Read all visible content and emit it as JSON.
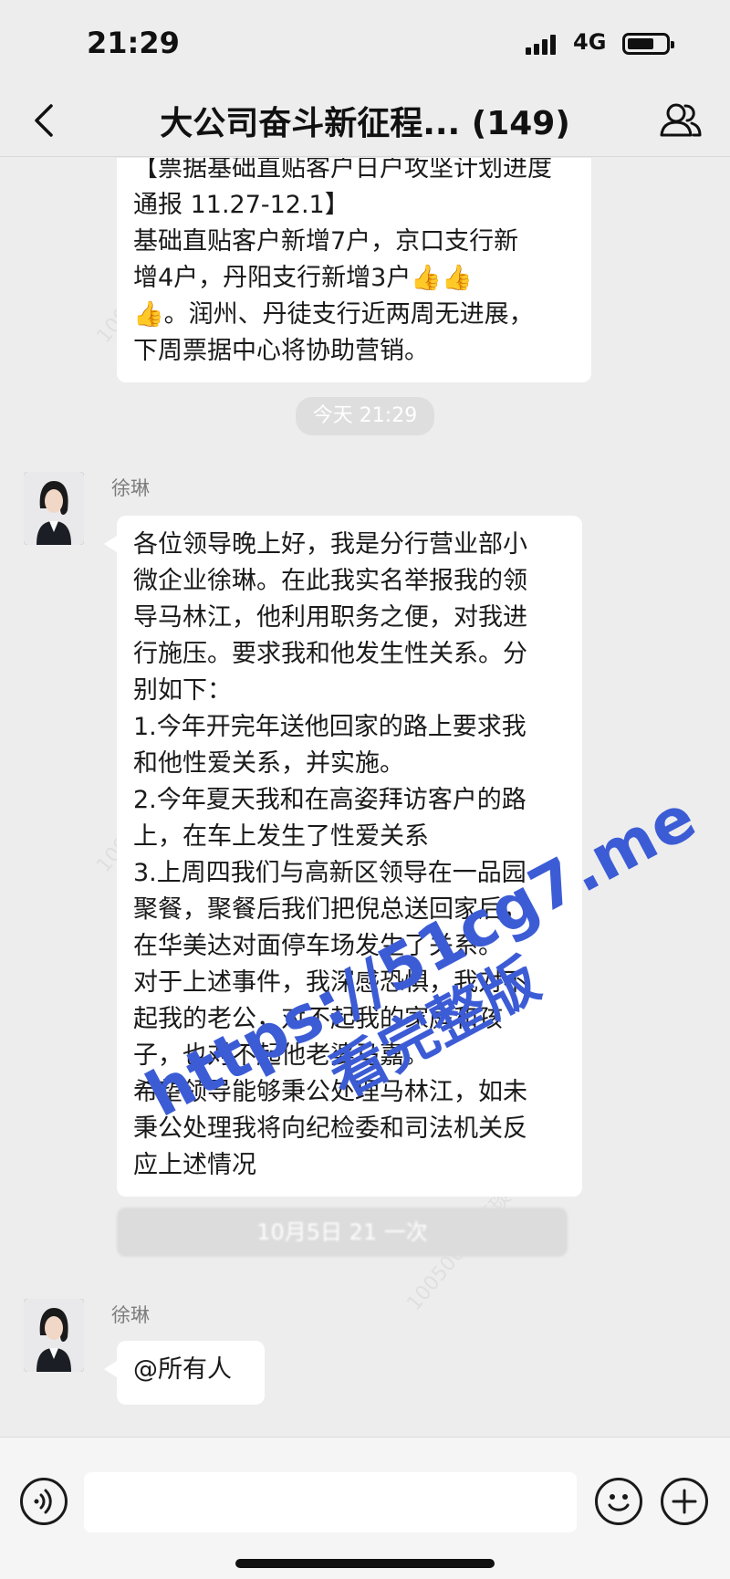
{
  "status_bar": {
    "time": "21:29",
    "network": "4G"
  },
  "nav": {
    "title": "大公司奋斗新征程... (149)"
  },
  "messages": {
    "previous_text": "【票据基础直贴客户日户攻坚计划进度\n通报 11.27-12.1】\n基础直贴客户新增7户，京口支行新\n增4户，丹阳支行新增3户👍👍\n👍。润州、丹徒支行近两周无进展，\n下周票据中心将协助营销。",
    "time_divider": "今天 21:29",
    "sender_1": "徐琳",
    "main_text": "各位领导晚上好，我是分行营业部小\n微企业徐琳。在此我实名举报我的领\n导马林江，他利用职务之便，对我进\n行施压。要求我和他发生性关系。分\n别如下：\n1.今年开完年送他回家的路上要求我\n和他性爱关系，并实施。\n2.今年夏天我和在高姿拜访客户的路\n上，在车上发生了性爱关系\n3.上周四我们与高新区领导在一品园\n聚餐，聚餐后我们把倪总送回家后，\n在华美达对面停车场发生了关系。\n对于上述事件，我深感恐惧，我对不\n起我的老公，对不起我的家庭和孩\n子，也对不起他老婆马嘉。\n希望领导能够秉公处理马林江，如未\n秉公处理我将向纪检委和司法机关反\n应上述情况",
    "system_notice": "10月5日 21   一次",
    "sender_2": "徐琳",
    "at_text": "@所有人"
  },
  "watermark": {
    "url": "https://51cg7.me",
    "text": "看完整版",
    "faint_1": "10050013 董琰",
    "faint_2": "10050013 董琰",
    "faint_3": "10050013 董琰"
  },
  "colors": {
    "background": "#ededed",
    "bubble": "#ffffff",
    "watermark": "#3c5cd6"
  },
  "icons": [
    "back-chevron-icon",
    "members-icon",
    "voice-icon",
    "emoji-icon",
    "plus-icon"
  ]
}
